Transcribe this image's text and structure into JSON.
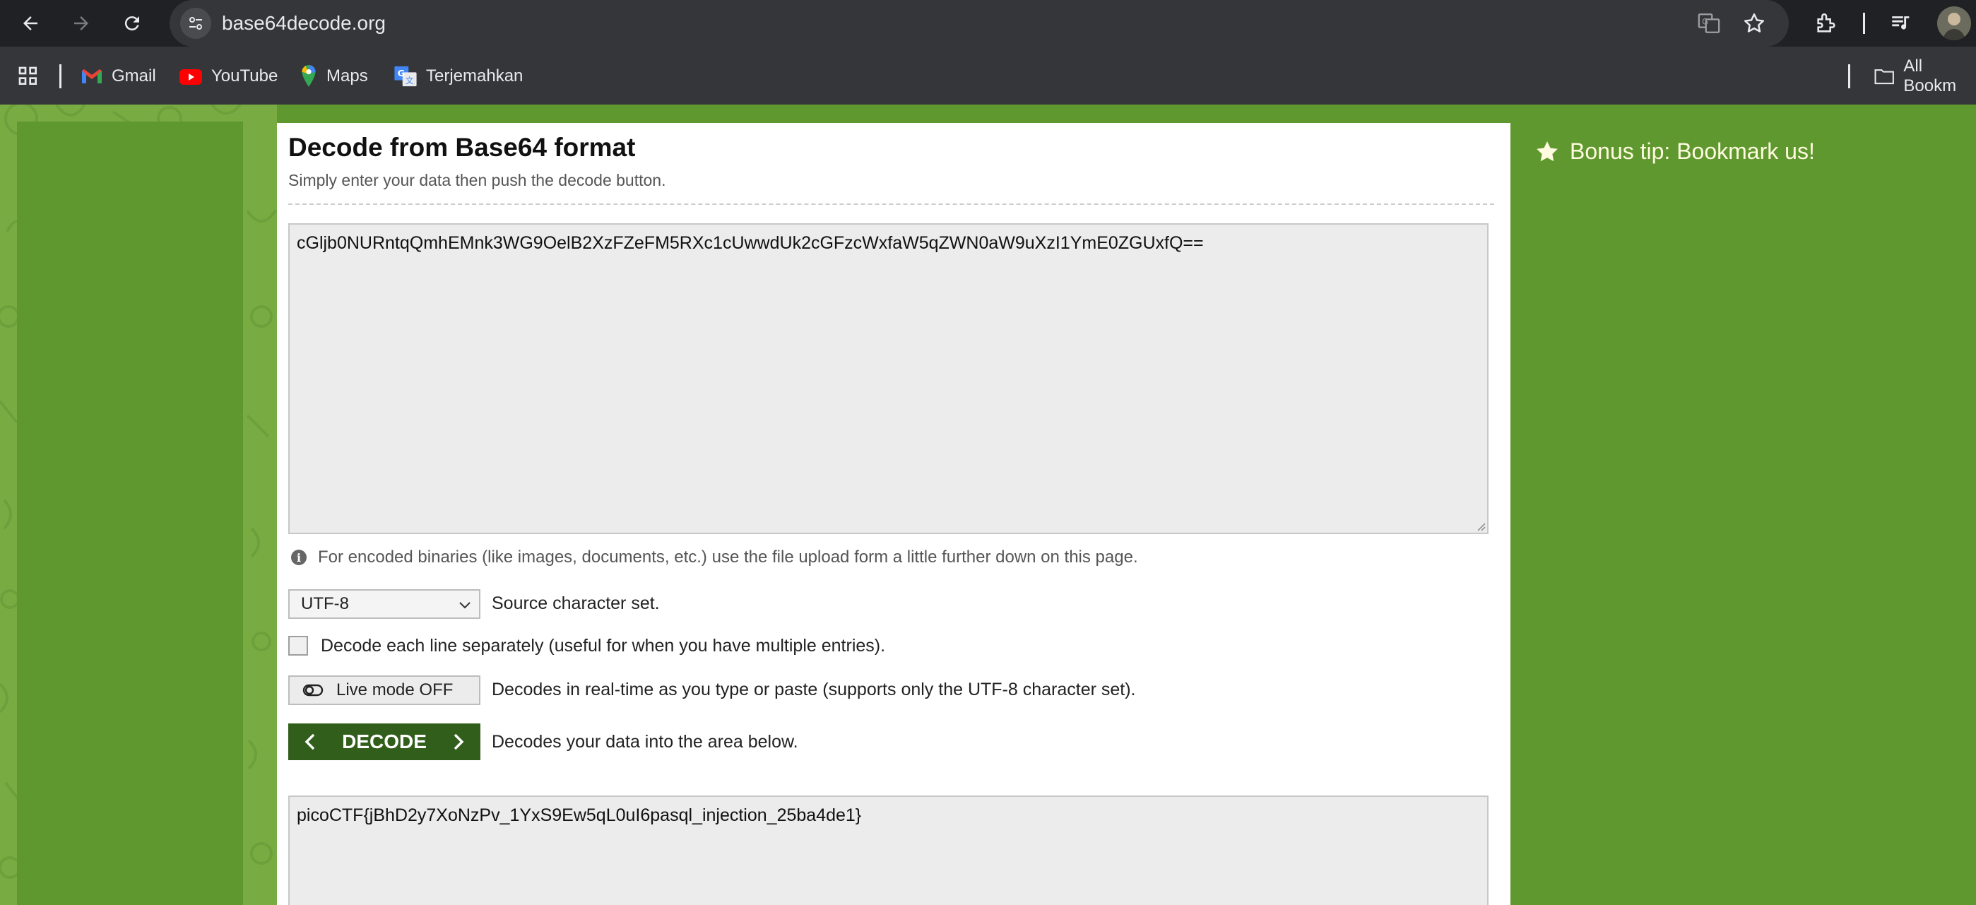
{
  "browser": {
    "url": "base64decode.org",
    "bookmarks": [
      {
        "label": "Gmail",
        "icon": "gmail-icon"
      },
      {
        "label": "YouTube",
        "icon": "youtube-icon"
      },
      {
        "label": "Maps",
        "icon": "maps-icon"
      },
      {
        "label": "Terjemahkan",
        "icon": "translate-icon"
      }
    ],
    "all_bookmarks_label": "All Bookm"
  },
  "page": {
    "title": "Decode from Base64 format",
    "subtitle": "Simply enter your data then push the decode button.",
    "input_value": "cGljb0NURntqQmhEMnk3WG9OelB2XzFZeFM5RXc1cUwwdUk2cGFzcWxfaW5qZWN0aW9uXzI1YmE0ZGUxfQ==",
    "info_text": "For encoded binaries (like images, documents, etc.) use the file upload form a little further down on this page.",
    "charset": {
      "selected": "UTF-8",
      "label": "Source character set."
    },
    "decode_each_line": {
      "checked": false,
      "label": "Decode each line separately (useful for when you have multiple entries)."
    },
    "live_mode": {
      "label": "Live mode OFF",
      "description": "Decodes in real-time as you type or paste (supports only the UTF-8 character set)."
    },
    "decode_button": {
      "label": "DECODE",
      "description": "Decodes your data into the area below."
    },
    "output_value": "picoCTF{jBhD2y7XoNzPv_1YxS9Ew5qL0uI6pasql_injection_25ba4de1}",
    "bonus_tip": "Bonus tip: Bookmark us!"
  },
  "colors": {
    "page_green": "#5f982f",
    "button_green": "#325e1b",
    "chrome_dark": "#202124"
  }
}
